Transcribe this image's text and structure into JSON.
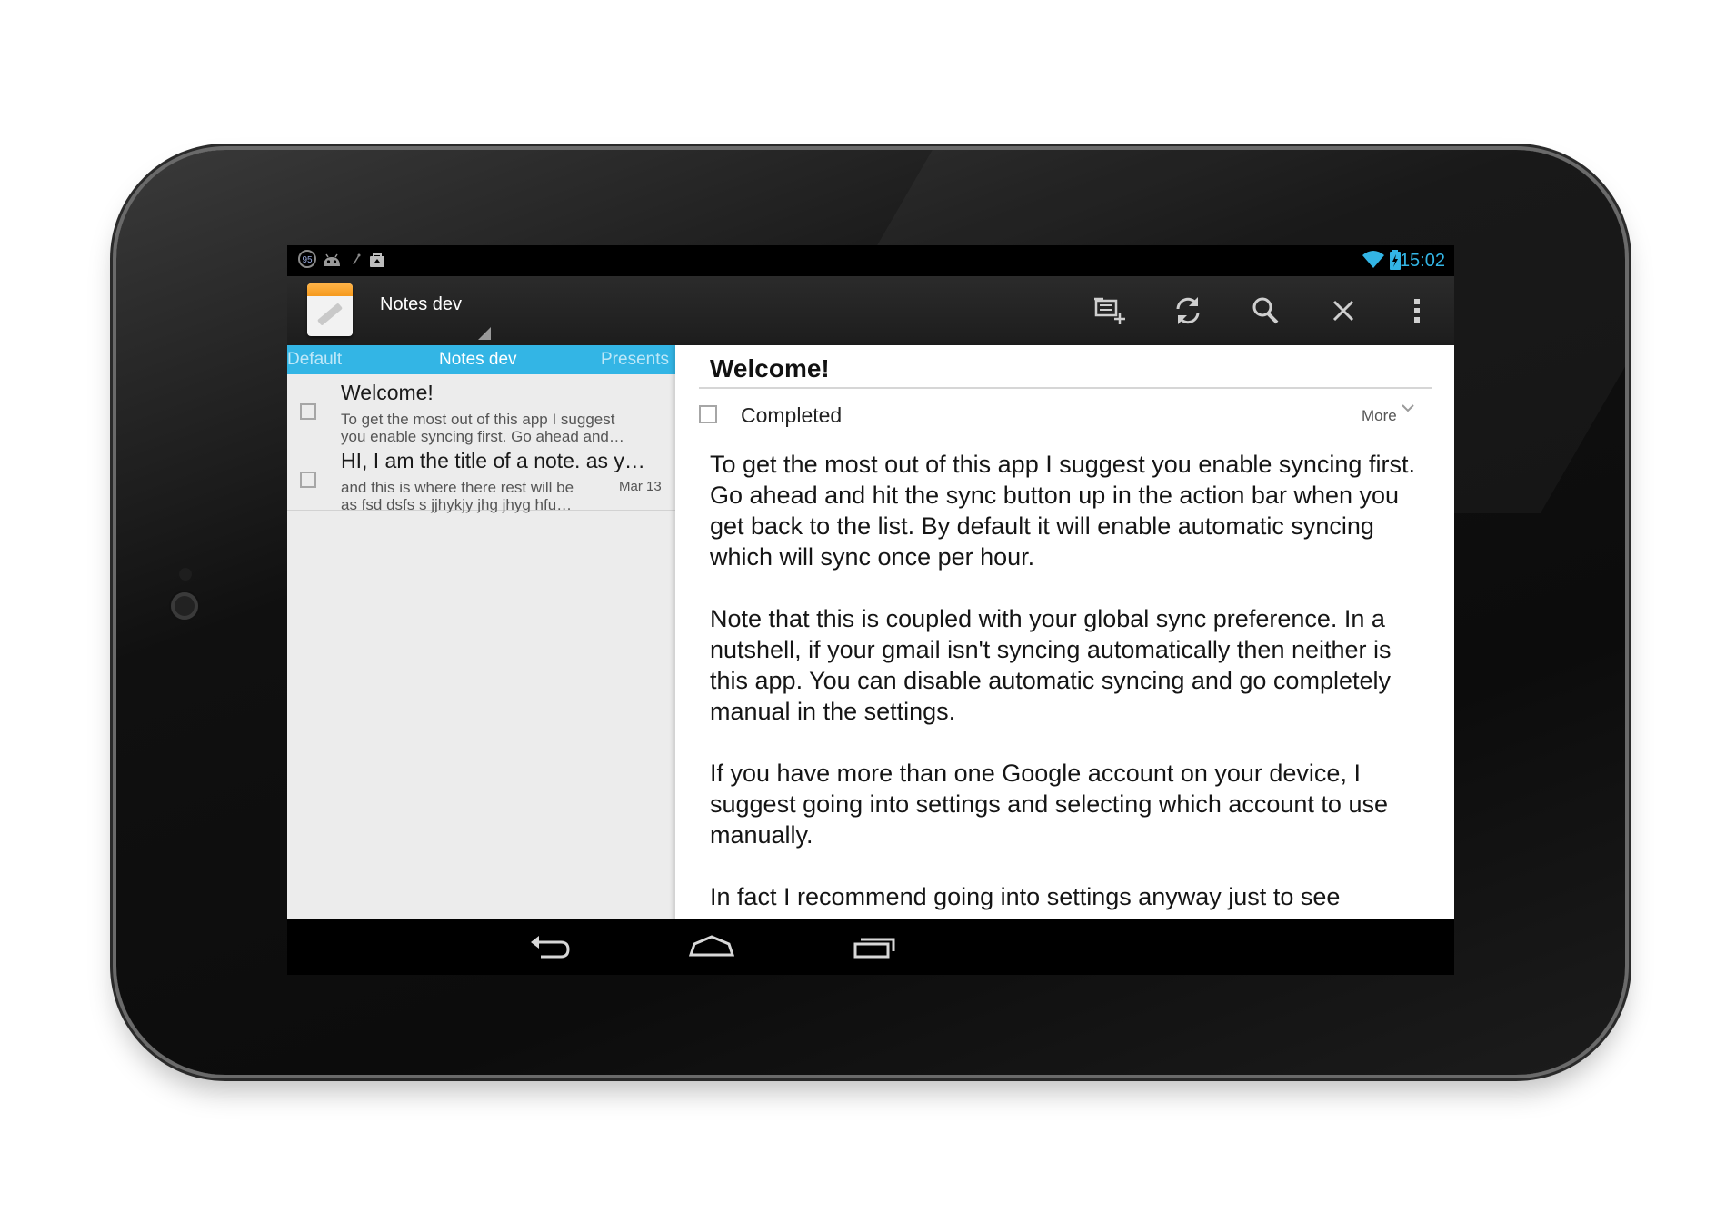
{
  "status_bar": {
    "notification_badge": "95",
    "time": "15:02",
    "icons": [
      "circle-95-icon",
      "android-icon",
      "usb-icon",
      "shopping-bag-icon",
      "wifi-icon",
      "battery-charging-icon"
    ]
  },
  "action_bar": {
    "app_icon": "notes-app-icon",
    "title": "Notes dev",
    "actions": [
      "new-note-icon",
      "sync-icon",
      "search-icon",
      "close-icon",
      "overflow-menu-icon"
    ]
  },
  "tabs": [
    {
      "label": "Default"
    },
    {
      "label": "Notes dev",
      "active": true
    },
    {
      "label": "Presents"
    }
  ],
  "notes": [
    {
      "title": "Welcome!",
      "line1": "To get the most out of this app I suggest",
      "line2": "you enable syncing first. Go ahead and…",
      "date": ""
    },
    {
      "title": "HI, I am the title of a note. as y…",
      "line1": "and this is where there rest will be",
      "line2": "as fsd dsfs s jjhykjy jhg jhyg hfu…",
      "date": "Mar 13"
    }
  ],
  "detail": {
    "title": "Welcome!",
    "completed_label": "Completed",
    "more_label": "More",
    "paragraphs": [
      "To get the most out of this app I suggest you enable syncing first. Go ahead and hit the sync button up in the action bar when you get back to the list. By default it will enable automatic syncing which will sync once per hour.",
      "Note that this is coupled with your global sync preference. In a nutshell, if your gmail isn't syncing automatically then neither is this app. You can disable automatic syncing and go completely manual in the settings.",
      "If you have more than one Google account on your device, I suggest going into settings and selecting which account to use manually.",
      "In fact I recommend going into settings anyway just to see"
    ]
  },
  "nav_bar": {
    "buttons": [
      "back-icon",
      "home-icon",
      "recents-icon"
    ]
  },
  "colors": {
    "accent": "#33b5e5",
    "action_bar": "#222222",
    "list_background": "#ececec"
  }
}
